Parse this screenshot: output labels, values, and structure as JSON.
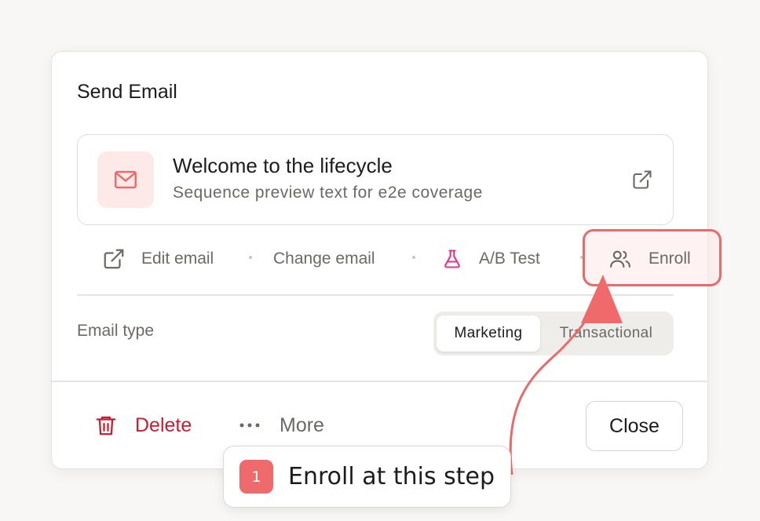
{
  "dialog": {
    "title": "Send Email",
    "email": {
      "name": "Welcome to the lifecycle",
      "preview": "Sequence preview text for e2e coverage"
    },
    "actions": {
      "edit": "Edit email",
      "change": "Change email",
      "ab_test": "A/B Test",
      "enroll": "Enroll"
    },
    "email_type": {
      "label": "Email type",
      "options": [
        "Marketing",
        "Transactional"
      ],
      "selected": "Marketing"
    },
    "footer": {
      "delete": "Delete",
      "more": "More",
      "close": "Close"
    }
  },
  "callout": {
    "number": "1",
    "text": "Enroll at this step"
  },
  "icons": {
    "email": "mail-icon",
    "open_external": "external-link-icon",
    "edit": "external-link-icon",
    "ab_test": "flask-icon",
    "enroll": "users-icon",
    "delete": "trash-icon",
    "more": "ellipsis-icon"
  },
  "colors": {
    "accent": "#e96a6a",
    "danger": "#c51d32",
    "ab_test": "#e0338a"
  }
}
